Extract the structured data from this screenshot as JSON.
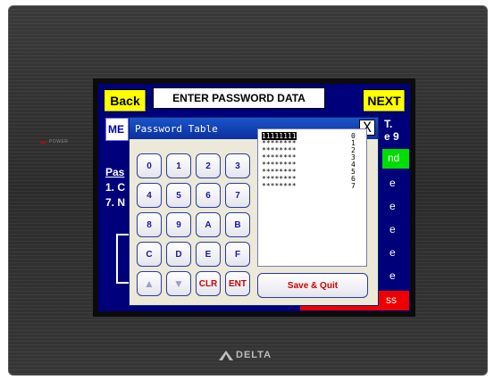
{
  "device": {
    "power_label": "POWER",
    "brand": "DELTA"
  },
  "screen": {
    "back_label": "Back",
    "title": "ENTER PASSWORD DATA",
    "next_label": "NEXT",
    "me_label": "ME",
    "right_text_1": "T.",
    "right_text_2": "e 9",
    "green_text": "nd",
    "right_e": "e",
    "red_text": "ss",
    "left_pas": "Pas",
    "left_line1": "1. C",
    "left_line2": "7. N"
  },
  "dialog": {
    "title": "Password Table",
    "close_label": "X",
    "keys": [
      [
        "0",
        "1",
        "2",
        "3"
      ],
      [
        "4",
        "5",
        "6",
        "7"
      ],
      [
        "8",
        "9",
        "A",
        "B"
      ],
      [
        "C",
        "D",
        "E",
        "F"
      ]
    ],
    "bottom_keys": {
      "up": "▲",
      "down": "▼",
      "clr": "CLR",
      "ent": "ENT"
    },
    "save_label": "Save & Quit",
    "rows": [
      {
        "password": "11111111",
        "index": "0",
        "selected": true
      },
      {
        "password": "********",
        "index": "1",
        "selected": false
      },
      {
        "password": "********",
        "index": "2",
        "selected": false
      },
      {
        "password": "********",
        "index": "3",
        "selected": false
      },
      {
        "password": "********",
        "index": "4",
        "selected": false
      },
      {
        "password": "********",
        "index": "5",
        "selected": false
      },
      {
        "password": "********",
        "index": "6",
        "selected": false
      },
      {
        "password": "********",
        "index": "7",
        "selected": false
      }
    ]
  },
  "colors": {
    "screen_bg": "#00007a",
    "yellow_button": "#ffff00",
    "green_status": "#00dd00",
    "red_status": "#ee0000",
    "dialog_title_bar": "#0a30a0"
  }
}
